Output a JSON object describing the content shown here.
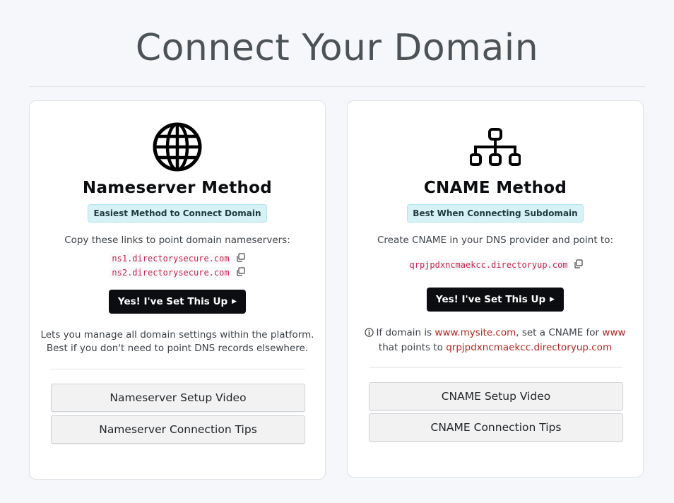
{
  "page": {
    "title": "Connect Your Domain"
  },
  "nameserver": {
    "title": "Nameserver Method",
    "badge": "Easiest Method to Connect Domain",
    "instruction": "Copy these links to point domain nameservers:",
    "ns1": "ns1.directorysecure.com",
    "ns2": "ns2.directorysecure.com",
    "confirm_button": "Yes! I've Set This Up",
    "note_line1": "Lets you manage all domain settings within the platform.",
    "note_line2": "Best if you don't need to point DNS records elsewhere.",
    "video_button": "Nameserver Setup Video",
    "tips_button": "Nameserver Connection Tips",
    "icon": "globe-icon"
  },
  "cname": {
    "title": "CNAME Method",
    "badge": "Best When Connecting Subdomain",
    "instruction": "Create CNAME in your DNS provider and point to:",
    "target": "qrpjpdxncmaekcc.directoryup.com",
    "confirm_button": "Yes! I've Set This Up",
    "hint_prefix": "If domain is",
    "hint_example_domain": "www.mysite.com",
    "hint_middle": ", set a CNAME for",
    "hint_subdomain": "www",
    "hint_line2_prefix": "that points to",
    "hint_target": "qrpjpdxncmaekcc.directoryup.com",
    "video_button": "CNAME Setup Video",
    "tips_button": "CNAME Connection Tips",
    "icon": "sitemap-icon"
  },
  "colors": {
    "background": "#f5f7fa",
    "badge_bg": "#d6f2f7",
    "code": "#c7254e",
    "link_red": "#b3261e",
    "button_dark": "#0b0d10"
  }
}
